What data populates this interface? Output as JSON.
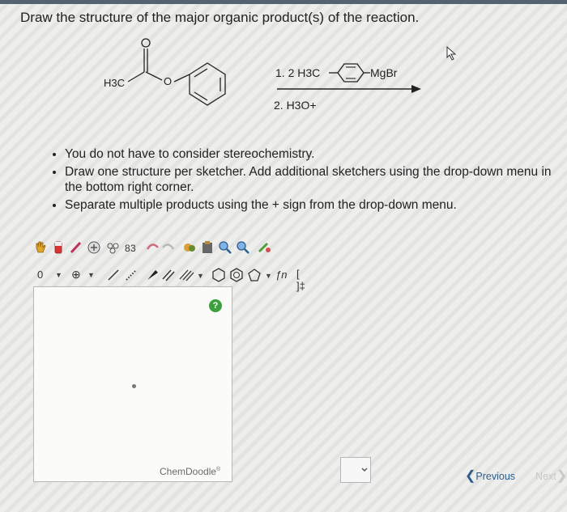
{
  "question": "Draw the structure of the major organic product(s) of the reaction.",
  "reaction": {
    "reactant_methyl": "H3C",
    "reactant_oxygen": "O",
    "step1_prefix": "1. 2 H3C",
    "step1_suffix": "MgBr",
    "step2": "2. H3O+"
  },
  "instructions": [
    "You do not have to consider stereochemistry.",
    "Draw one structure per sketcher. Add additional sketchers using the drop-down menu in the bottom right corner.",
    "Separate multiple products using the + sign from the drop-down menu."
  ],
  "toolbar": {
    "charge_label": "0",
    "charge_plus": "⊕",
    "functional_text": "ƒn",
    "bracket_text": "[ ]‡"
  },
  "sketcher": {
    "help_label": "?",
    "brand": "ChemDoodle",
    "brand_mark": "®"
  },
  "navigation": {
    "previous": "Previous",
    "next": "Next"
  }
}
